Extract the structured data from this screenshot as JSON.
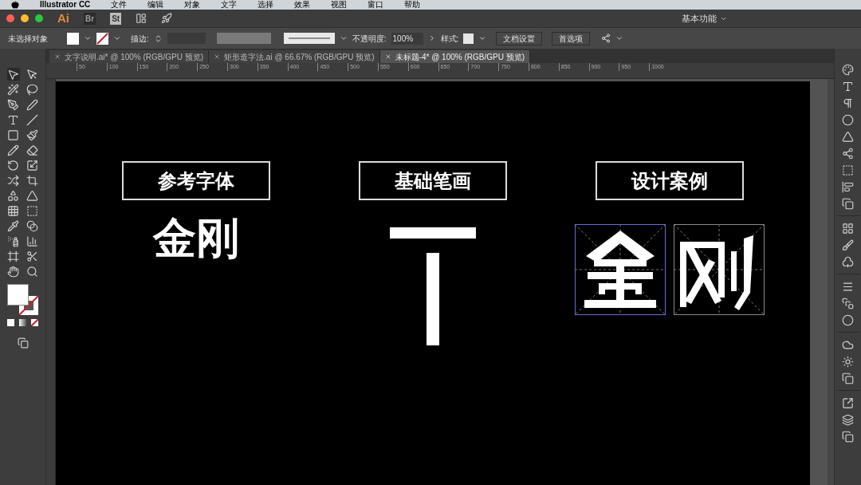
{
  "menu_bar": {
    "app": "Illustrator CC",
    "items": [
      "文件",
      "编辑",
      "对象",
      "文字",
      "选择",
      "效果",
      "视图",
      "窗口",
      "帮助"
    ]
  },
  "app_bar": {
    "logo": "Ai",
    "apps": [
      {
        "label": "Br",
        "disabled": true
      },
      {
        "label": "St",
        "disabled": false
      }
    ],
    "workspace": "基本功能"
  },
  "control_bar": {
    "selection": "未选择对象",
    "stroke_label": "描边:",
    "opacity_label": "不透明度:",
    "opacity": "100%",
    "style_label": "样式:",
    "buttons": [
      "文档设置",
      "首选项"
    ]
  },
  "tabs": [
    {
      "label": "文字说明.ai* @ 100% (RGB/GPU 预览)",
      "selected": false
    },
    {
      "label": "矩形造字法.ai @ 66.67% (RGB/GPU 预览)",
      "selected": false
    },
    {
      "label": "未标题-4* @ 100% (RGB/GPU 预览)",
      "selected": true
    }
  ],
  "ruler": {
    "ticks": [
      "50",
      "100",
      "150",
      "200",
      "250",
      "300",
      "350",
      "400",
      "450",
      "500",
      "550",
      "600",
      "650",
      "700",
      "750",
      "800",
      "850",
      "900",
      "950",
      "1000"
    ]
  },
  "artboard": {
    "sections": [
      {
        "kind": "text",
        "title": "参考字体",
        "sample": "金刚"
      },
      {
        "kind": "stroke",
        "title": "基础笔画"
      },
      {
        "kind": "design",
        "title": "设计案例"
      }
    ]
  }
}
